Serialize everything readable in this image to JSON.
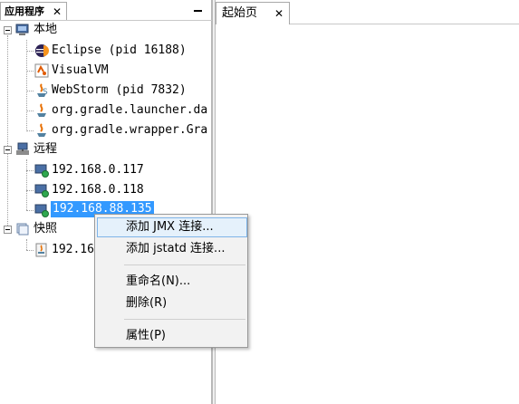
{
  "left_panel": {
    "tab_label": "应用程序",
    "close_glyph": "✕"
  },
  "tree": {
    "local": {
      "label": "本地",
      "children": [
        "Eclipse (pid 16188)",
        "VisualVM",
        "WebStorm (pid 7832)",
        "org.gradle.launcher.da",
        "org.gradle.wrapper.Gra"
      ]
    },
    "remote": {
      "label": "远程",
      "children": [
        "192.168.0.117",
        "192.168.0.118",
        "192.168.88.135"
      ]
    },
    "snapshots": {
      "label": "快照",
      "children": [
        "192.16"
      ]
    }
  },
  "right_area": {
    "tab_label": "起始页",
    "close_glyph": "✕"
  },
  "context_menu": {
    "items": [
      "添加 JMX 连接...",
      "添加 jstatd 连接...",
      "重命名(N)...",
      "删除(R)",
      "属性(P)"
    ],
    "highlighted_index": 0
  },
  "colors": {
    "selection": "#3399ff",
    "menu_bg": "#f2f2f2",
    "menu_highlight": "#e5f1fb"
  }
}
